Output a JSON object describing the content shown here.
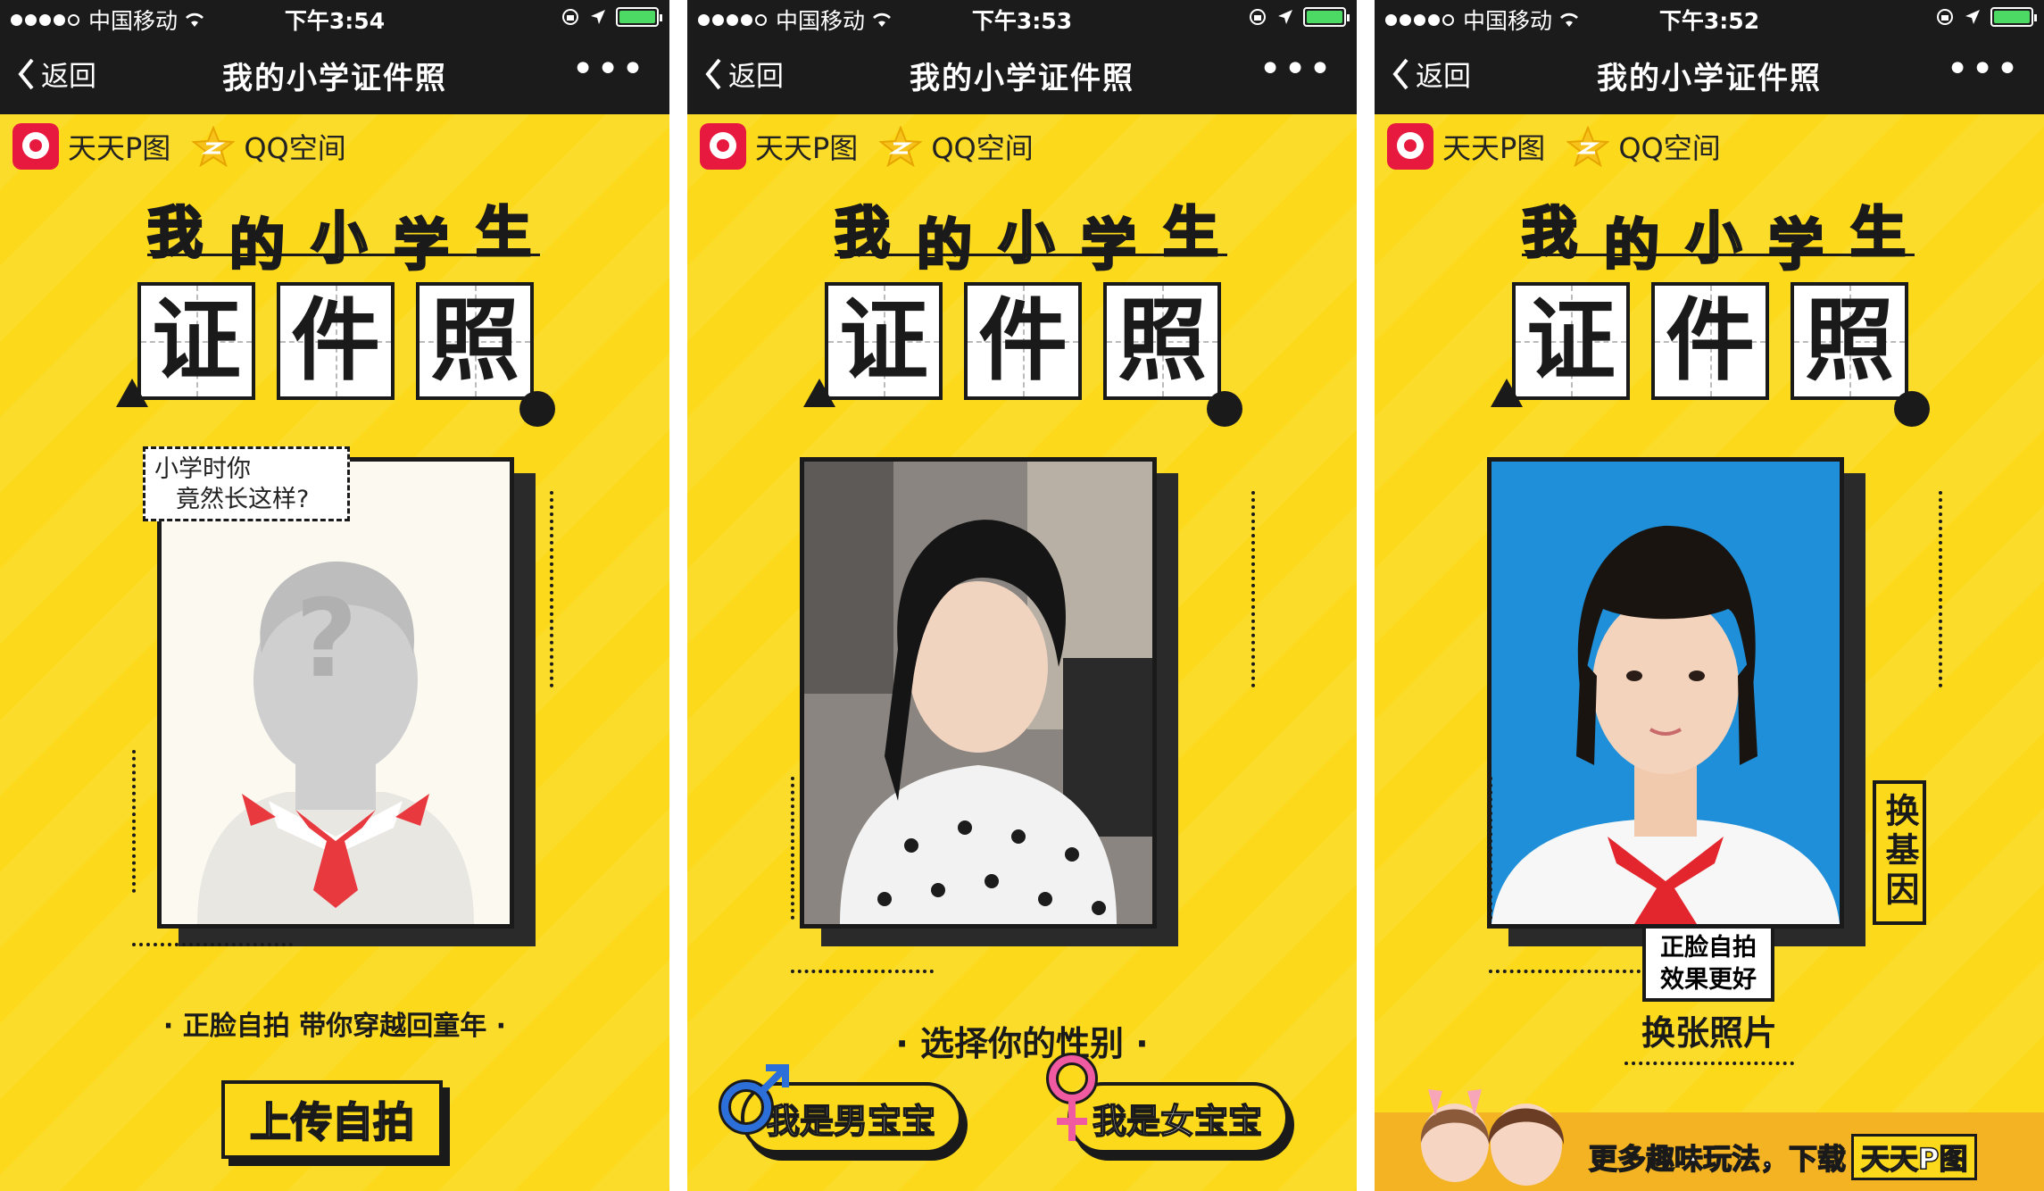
{
  "status_bar": {
    "carrier": "中国移动",
    "times": [
      "下午3:54",
      "下午3:53",
      "下午3:52"
    ]
  },
  "nav": {
    "back_label": "返回",
    "title": "我的小学证件照",
    "more_label": "•••"
  },
  "brands": {
    "ttpt": "天天P图",
    "qzone": "QQ空间"
  },
  "headline": {
    "chars": [
      "我",
      "的",
      "小",
      "学",
      "生"
    ],
    "colors": [
      "#e8193f",
      "#2d6fd8",
      "#fcd91a",
      "#ef5aa0",
      "#2d9de0"
    ],
    "boxes": [
      "证",
      "件",
      "照"
    ]
  },
  "screen1": {
    "caption_line1": "小学时你",
    "caption_line2": "竟然长这样?",
    "placeholder_mark": "?",
    "tagline": "· 正脸自拍 带你穿越回童年 ·",
    "upload_button": "上传自拍"
  },
  "screen2": {
    "tagline": "· 选择你的性别 ·",
    "male_button": "我是男宝宝",
    "female_button": "我是女宝宝"
  },
  "screen3": {
    "side_button": "换基因",
    "bubble_line1": "正脸自拍",
    "bubble_line2": "效果更好",
    "change_photo": "换张照片",
    "banner_text": "更多趣味玩法，下载",
    "banner_chip": "天天P图"
  },
  "colors": {
    "background": "#fcd91a",
    "topbar": "#1b1b1b",
    "ink": "#1a1a1a",
    "battery": "#4cd964"
  }
}
